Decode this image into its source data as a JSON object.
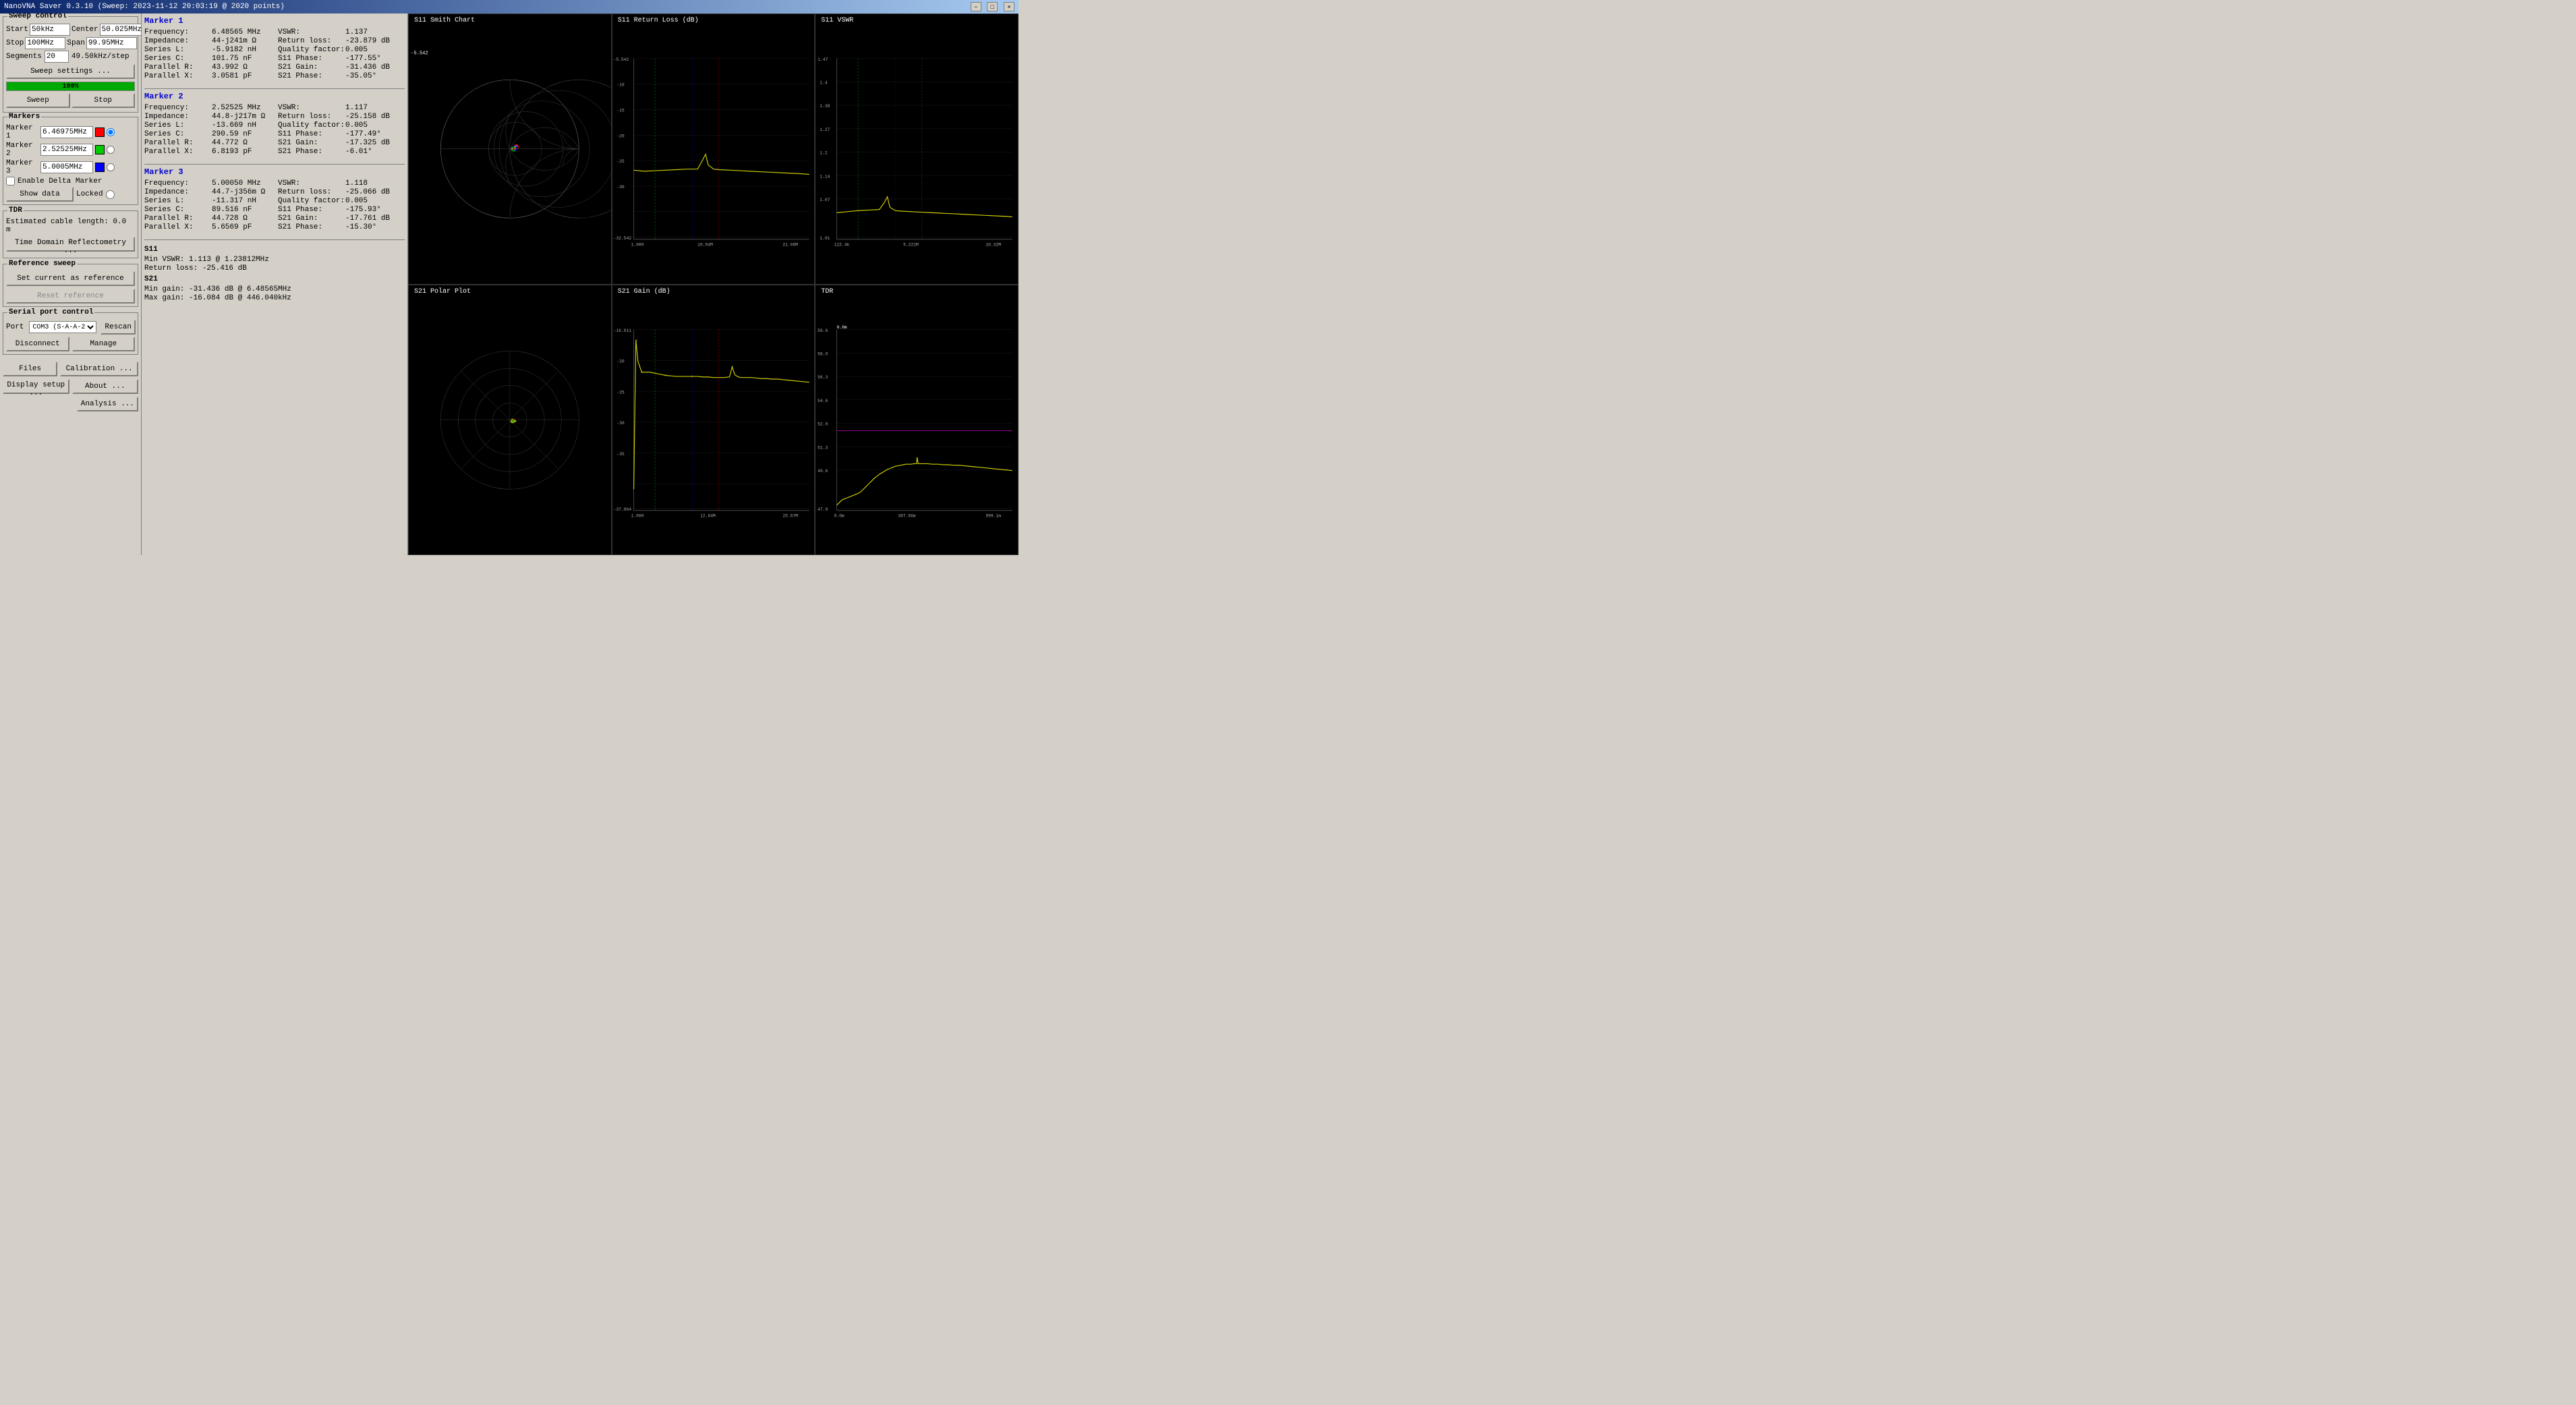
{
  "titlebar": {
    "title": "NanoVNA Saver 0.3.10 (Sweep: 2023-11-12 20:03:19 @ 2020 points)",
    "min": "−",
    "max": "□",
    "close": "×"
  },
  "sweep_control": {
    "label": "Sweep control",
    "start_label": "Start",
    "start_value": "50kHz",
    "center_label": "Center",
    "center_value": "50.025MHz",
    "stop_label": "Stop",
    "stop_value": "100MHz",
    "span_label": "Span",
    "span_value": "99.95MHz",
    "segments_label": "Segments",
    "segments_value": "20",
    "step_value": "49.50kHz/step",
    "settings_btn": "Sweep settings ...",
    "progress_pct": "100%",
    "sweep_btn": "Sweep",
    "stop_btn": "Stop"
  },
  "markers": {
    "label": "Markers",
    "marker1_label": "Marker 1",
    "marker1_value": "6.46975MHz",
    "marker1_color": "#ff0000",
    "marker2_label": "Marker 2",
    "marker2_value": "2.52525MHz",
    "marker2_color": "#00cc00",
    "marker3_label": "Marker 3",
    "marker3_value": "5.0005MHz",
    "marker3_color": "#0000ff",
    "enable_delta": "Enable Delta Marker",
    "show_data_btn": "Show data",
    "locked_label": "Locked"
  },
  "tdr": {
    "label": "TDR",
    "estimated_label": "Estimated cable length: 0.0 m",
    "tdr_btn": "Time Domain Reflectometry ..."
  },
  "reference_sweep": {
    "label": "Reference sweep",
    "set_ref_btn": "Set current as reference",
    "reset_ref_btn": "Reset reference"
  },
  "serial_port": {
    "label": "Serial port control",
    "port_label": "Port",
    "port_value": "COM3 (S-A-A-2)",
    "rescan_btn": "Rescan",
    "disconnect_btn": "Disconnect",
    "manage_btn": "Manage"
  },
  "bottom_buttons": {
    "files_btn": "Files",
    "calibration_btn": "Calibration ...",
    "display_btn": "Display setup ...",
    "about_btn": "About ...",
    "analysis_btn": "Analysis ..."
  },
  "marker1_data": {
    "title": "Marker 1",
    "frequency_label": "Frequency:",
    "frequency_value": "6.48565 MHz",
    "impedance_label": "Impedance:",
    "impedance_value": "44-j241m Ω",
    "series_l_label": "Series L:",
    "series_l_value": "-5.9182 nH",
    "series_c_label": "Series C:",
    "series_c_value": "101.75 nF",
    "parallel_r_label": "Parallel R:",
    "parallel_r_value": "43.992 Ω",
    "parallel_x_label": "Parallel X:",
    "parallel_x_value": "3.0581 pF",
    "vswr_label": "VSWR:",
    "vswr_value": "1.137",
    "return_loss_label": "Return loss:",
    "return_loss_value": "-23.879 dB",
    "quality_label": "Quality factor:",
    "quality_value": "0.005",
    "s11_phase_label": "S11 Phase:",
    "s11_phase_value": "-177.55°",
    "s21_gain_label": "S21 Gain:",
    "s21_gain_value": "-31.436 dB",
    "s21_phase_label": "S21 Phase:",
    "s21_phase_value": "-35.05°"
  },
  "marker2_data": {
    "title": "Marker 2",
    "frequency_label": "Frequency:",
    "frequency_value": "2.52525 MHz",
    "impedance_label": "Impedance:",
    "impedance_value": "44.8-j217m Ω",
    "series_l_label": "Series L:",
    "series_l_value": "-13.669 nH",
    "series_c_label": "Series C:",
    "series_c_value": "290.59 nF",
    "parallel_r_label": "Parallel R:",
    "parallel_r_value": "44.772 Ω",
    "parallel_x_label": "Parallel X:",
    "parallel_x_value": "6.8193 pF",
    "vswr_label": "VSWR:",
    "vswr_value": "1.117",
    "return_loss_label": "Return loss:",
    "return_loss_value": "-25.158 dB",
    "quality_label": "Quality factor:",
    "quality_value": "0.005",
    "s11_phase_label": "S11 Phase:",
    "s11_phase_value": "-177.49°",
    "s21_gain_label": "S21 Gain:",
    "s21_gain_value": "-17.325 dB",
    "s21_phase_label": "S21 Phase:",
    "s21_phase_value": "-6.01°"
  },
  "marker3_data": {
    "title": "Marker 3",
    "frequency_label": "Frequency:",
    "frequency_value": "5.00050 MHz",
    "impedance_label": "Impedance:",
    "impedance_value": "44.7-j356m Ω",
    "series_l_label": "Series L:",
    "series_l_value": "-11.317 nH",
    "series_c_label": "Series C:",
    "series_c_value": "89.516 nF",
    "parallel_r_label": "Parallel R:",
    "parallel_r_value": "44.728 Ω",
    "parallel_x_label": "Parallel X:",
    "parallel_x_value": "5.6569 pF",
    "vswr_label": "VSWR:",
    "vswr_value": "1.118",
    "return_loss_label": "Return loss:",
    "return_loss_value": "-25.066 dB",
    "quality_label": "Quality factor:",
    "quality_value": "0.005",
    "s11_phase_label": "S11 Phase:",
    "s11_phase_value": "-175.93°",
    "s21_gain_label": "S21 Gain:",
    "s21_gain_value": "-17.761 dB",
    "s21_phase_label": "S21 Phase:",
    "s21_phase_value": "-15.30°"
  },
  "s_params": {
    "title": "S11",
    "min_vswr_label": "Min VSWR:",
    "min_vswr_value": "1.113 @ 1.23812MHz",
    "return_loss_label": "Return loss:",
    "return_loss_value": "-25.416 dB",
    "s21_title": "S21",
    "min_gain_label": "Min gain:",
    "min_gain_value": "-31.436 dB @ 6.48565MHz",
    "max_gain_label": "Max gain:",
    "max_gain_value": "-16.084 dB @ 446.040kHz"
  },
  "charts": {
    "smith": {
      "title": "S11 Smith Chart",
      "y_min": "-5.542",
      "y_max": ""
    },
    "return_loss": {
      "title": "S11 Return Loss (dB)",
      "y_top": "-5.542",
      "y_mid1": "-10",
      "y_mid2": "-15",
      "y_mid3": "-20",
      "y_mid4": "-25",
      "y_bot": "-32.542",
      "x_left": "1.000",
      "x_mid": "10.54M",
      "x_right": "21.08M"
    },
    "vswr": {
      "title": "S11 VSWR",
      "y_top": "1.47",
      "y_m1": "1.4",
      "y_m2": "1.38",
      "y_m3": "1.27",
      "y_m4": "1.2",
      "y_m5": "1.14",
      "y_m6": "1.07",
      "y_bot": "1.01",
      "x_left": "122.4k",
      "x_mid": "5.221M",
      "x_right": "10.32M"
    },
    "polar": {
      "title": "S21 Polar Plot"
    },
    "s21_gain": {
      "title": "S21 Gain (dB)",
      "y_top": "-16.011",
      "y_m1": "-20",
      "y_m2": "-25",
      "y_m3": "-30",
      "y_m4": "-35",
      "y_bot": "-37.864",
      "x_left": "1.000",
      "x_mid": "12.84M",
      "x_right": "25.67M"
    },
    "tdr_chart": {
      "title": "TDR",
      "y_top": "59.6",
      "y_m1": "58.0",
      "y_m2": "56.3",
      "y_m3": "54.6",
      "y_m4": "52.9",
      "y_m5": "51.3",
      "y_m6": "49.6",
      "y_bot": "47.9",
      "x_left": "0.0m",
      "x_mid": "387.66m",
      "x_right": "999.1m",
      "label_0": "0.0m",
      "label_ref": "387.66m",
      "label_end": "999.1m"
    }
  }
}
